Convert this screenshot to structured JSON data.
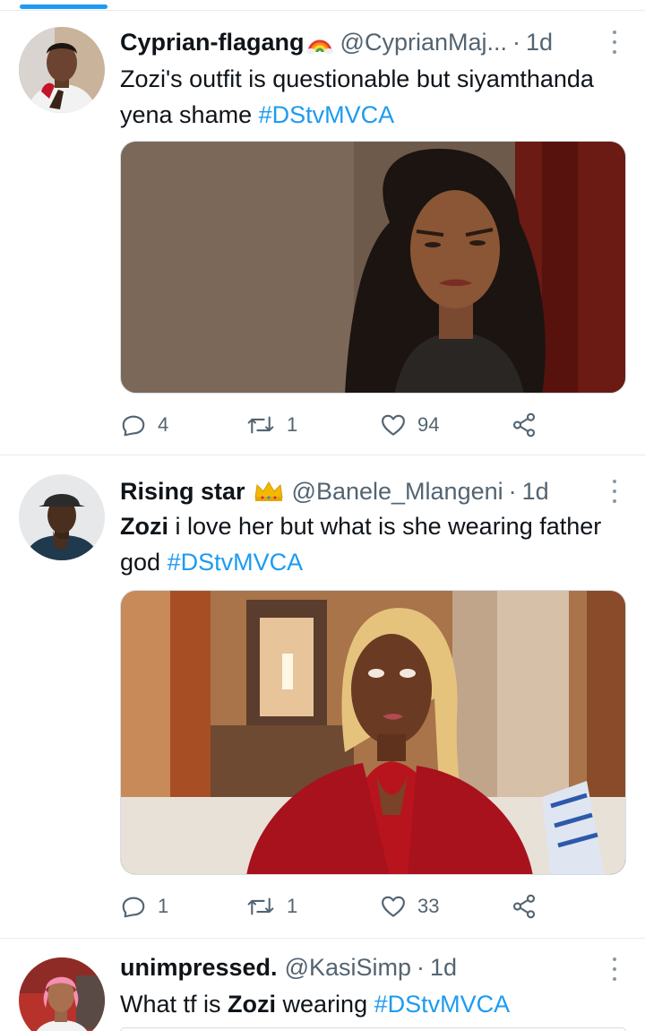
{
  "tweets": [
    {
      "display_name": "Cyprian-flagang",
      "handle": "@CyprianMaj...",
      "separator": "·",
      "time": "1d",
      "text_parts": [
        "Zozi's outfit is questionable but siyamthanda yena shame ",
        "#DStvMVCA"
      ],
      "media_icon": "photo-woman-grimacing",
      "replies": "4",
      "retweets": "1",
      "likes": "94"
    },
    {
      "display_name": "Rising star",
      "handle": "@Banele_Mlangeni",
      "separator": "·",
      "time": "1d",
      "text_parts": [
        "Zozi",
        " i love her but what is she wearing father god ",
        "#DStvMVCA"
      ],
      "media_icon": "photo-woman-eye-roll",
      "replies": "1",
      "retweets": "1",
      "likes": "33"
    },
    {
      "display_name": "unimpressed.",
      "handle": "@KasiSimp",
      "separator": "·",
      "time": "1d",
      "text_parts": [
        "What tf is ",
        "Zozi",
        " wearing ",
        "#DStvMVCA"
      ]
    }
  ],
  "colors": {
    "accent": "#1d9bf0",
    "text": "#0f1419",
    "muted": "#536471",
    "divider": "#e6ecf0"
  }
}
